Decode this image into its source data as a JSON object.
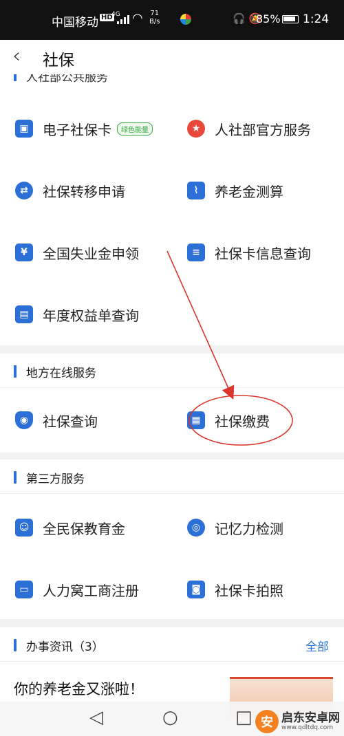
{
  "status_bar": {
    "carrier": "中国移动",
    "hd": "HD",
    "net": "4G",
    "speed_value": "71",
    "speed_unit": "B/s",
    "battery": "85%",
    "time": "1:24"
  },
  "nav": {
    "title": "社保"
  },
  "partial_section": {
    "title": "人社部公共服务"
  },
  "sections": {
    "public": {
      "items": [
        {
          "label": "电子社保卡",
          "badge": "绿色能量",
          "icon": "id-card-icon"
        },
        {
          "label": "人社部官方服务",
          "icon": "emblem-icon"
        },
        {
          "label": "社保转移申请",
          "icon": "transfer-icon"
        },
        {
          "label": "养老金测算",
          "icon": "chart-icon"
        },
        {
          "label": "全国失业金申领",
          "icon": "document-money-icon"
        },
        {
          "label": "社保卡信息查询",
          "icon": "card-search-icon"
        },
        {
          "label": "年度权益单查询",
          "icon": "person-doc-icon"
        }
      ]
    },
    "local": {
      "title": "地方在线服务",
      "items": [
        {
          "label": "社保查询",
          "icon": "shield-search-icon"
        },
        {
          "label": "社保缴费",
          "icon": "card-pay-icon"
        }
      ]
    },
    "third": {
      "title": "第三方服务",
      "items": [
        {
          "label": "全民保教育金",
          "icon": "person-card-icon"
        },
        {
          "label": "记忆力检测",
          "icon": "brain-shield-icon"
        },
        {
          "label": "人力窝工商注册",
          "icon": "briefcase-icon"
        },
        {
          "label": "社保卡拍照",
          "icon": "camera-person-icon"
        }
      ]
    },
    "news": {
      "title": "办事资讯（3）",
      "all_label": "全部",
      "items": [
        {
          "title": "你的养老金又涨啦！"
        }
      ]
    }
  },
  "watermark": {
    "text": "启东安卓网",
    "url": "www.qdltdq.com"
  },
  "colors": {
    "accent": "#2d6ed8",
    "annotation": "#d9352b",
    "badge_green": "#39a845"
  }
}
